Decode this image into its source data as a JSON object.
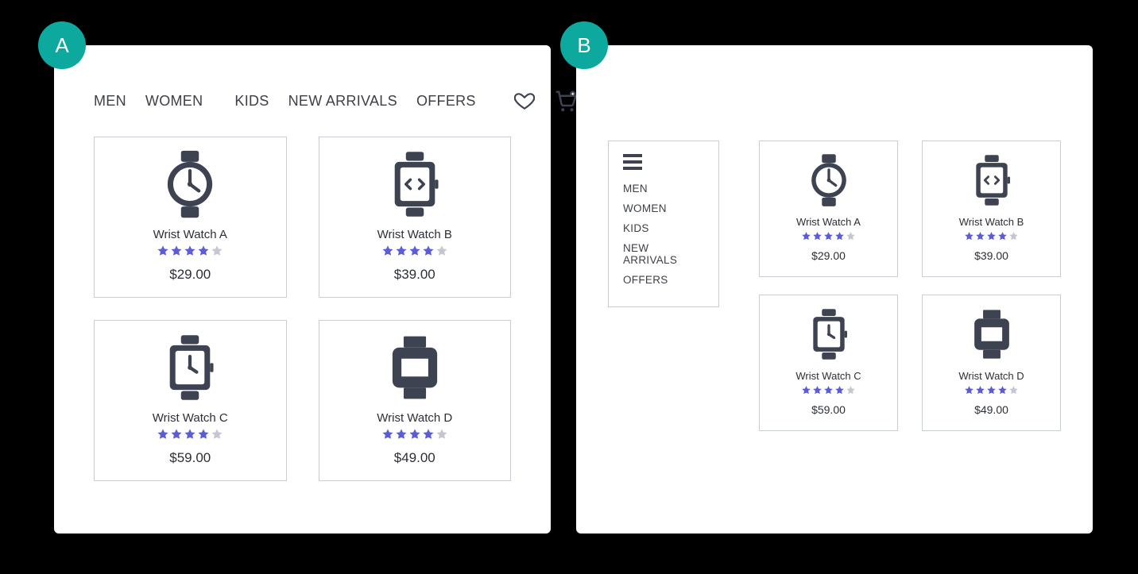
{
  "badges": {
    "a": "A",
    "b": "B"
  },
  "nav": {
    "items": [
      "MEN",
      "WOMEN",
      "KIDS",
      "NEW ARRIVALS",
      "OFFERS"
    ]
  },
  "products": [
    {
      "name": "Wrist Watch A",
      "price": "$29.00",
      "rating": 4,
      "icon": "watch-round"
    },
    {
      "name": "Wrist Watch B",
      "price": "$39.00",
      "rating": 4,
      "icon": "watch-square-code"
    },
    {
      "name": "Wrist Watch C",
      "price": "$59.00",
      "rating": 4,
      "icon": "watch-square-hands"
    },
    {
      "name": "Wrist Watch D",
      "price": "$49.00",
      "rating": 4,
      "icon": "watch-block"
    }
  ],
  "colors": {
    "accent": "#0da89e",
    "star_full": "#5b5dd6",
    "star_empty": "#c5c7d0",
    "ink": "#3e4352"
  }
}
